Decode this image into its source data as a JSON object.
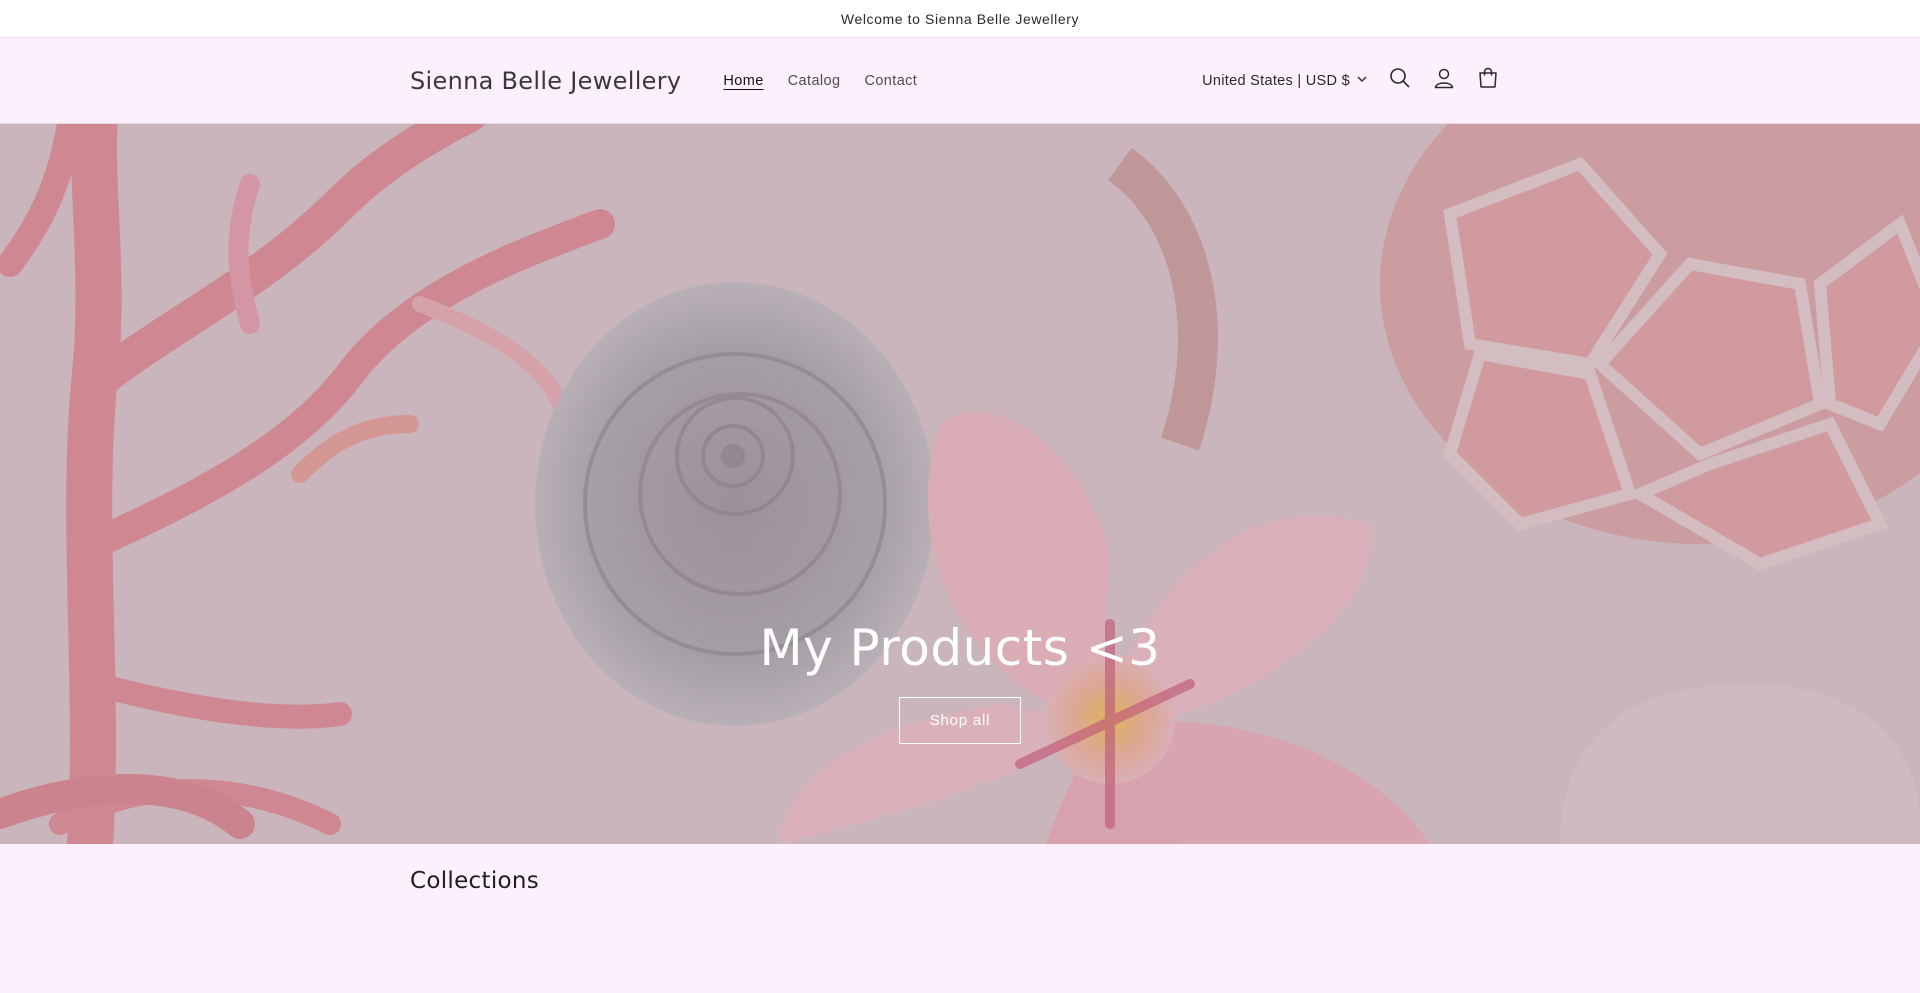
{
  "announcement": {
    "text": "Welcome to Sienna Belle Jewellery"
  },
  "header": {
    "logo": "Sienna Belle Jewellery",
    "nav": [
      {
        "label": "Home",
        "active": true
      },
      {
        "label": "Catalog",
        "active": false
      },
      {
        "label": "Contact",
        "active": false
      }
    ],
    "currency": "United States | USD $",
    "icons": [
      "search-icon",
      "account-icon",
      "cart-icon",
      "chevron-down-icon"
    ]
  },
  "hero": {
    "title": "My Products <3",
    "button_label": "Shop all"
  },
  "collections": {
    "heading": "Collections"
  },
  "colors": {
    "header_bg": "#fdf0fd",
    "announcement_bg": "#ffffff",
    "hero_text": "#ffffff",
    "coral": "#e58d98",
    "shell": "#9c9aa2"
  }
}
